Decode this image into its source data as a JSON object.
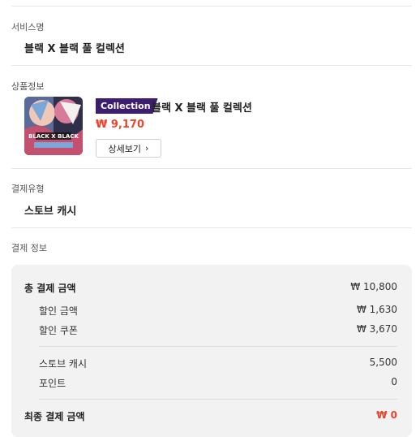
{
  "service": {
    "label": "서비스명",
    "value": "블랙 X 블랙 풀 컬렉션"
  },
  "product": {
    "label": "상품정보",
    "badge": "Collection",
    "title": "블랙 X 블랙 풀 컬렉션",
    "price": "₩ 9,170",
    "detail_button": "상세보기",
    "thumbnail_text": "BLACK X BLACK",
    "thumbnail_colors": [
      "#3a3a5a",
      "#c2506e",
      "#7aa7d8",
      "#f0c8b8"
    ]
  },
  "payment_type": {
    "label": "결제유형",
    "value": "스토브 캐시"
  },
  "payment_info": {
    "label": "결제 정보",
    "total_label": "총 결제 금액",
    "total_value": "₩ 10,800",
    "discount_label": "할인 금액",
    "discount_value": "₩ 1,630",
    "coupon_label": "할인 쿠폰",
    "coupon_value": "₩ 3,670",
    "cash_label": "스토브 캐시",
    "cash_value": "5,500",
    "point_label": "포인트",
    "point_value": "0",
    "final_label": "최종 결제 금액",
    "final_value": "₩ 0"
  },
  "colors": {
    "accent": "#e8452c",
    "badge_bg": "#3d1d6e",
    "box_bg": "#f2f2f2"
  }
}
